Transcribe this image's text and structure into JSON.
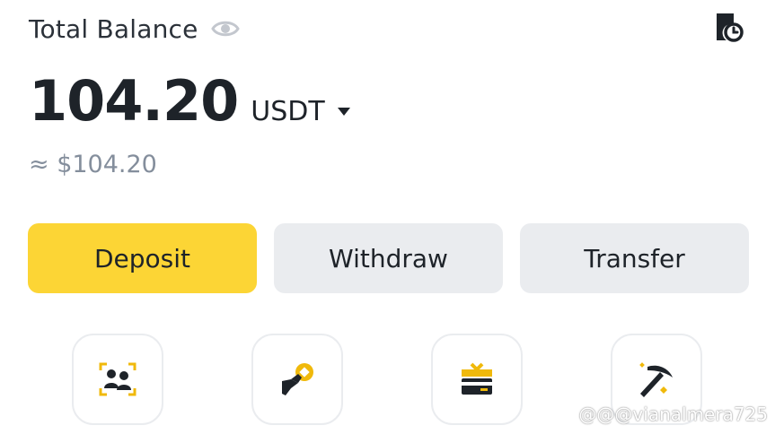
{
  "balance": {
    "label": "Total Balance",
    "amount": "104.20",
    "currency": "USDT",
    "fiat_equivalent": "≈ $104.20"
  },
  "actions": {
    "deposit_label": "Deposit",
    "withdraw_label": "Withdraw",
    "transfer_label": "Transfer"
  },
  "shortcuts": [
    {
      "icon": "referral-icon"
    },
    {
      "icon": "earn-icon"
    },
    {
      "icon": "gift-card-icon"
    },
    {
      "icon": "mining-pool-icon"
    }
  ],
  "watermark": "@@@vianalmera725",
  "colors": {
    "accent": "#fcd535",
    "secondary_button": "#eaecef",
    "text_primary": "#1e2329",
    "text_secondary": "#848e9c"
  }
}
